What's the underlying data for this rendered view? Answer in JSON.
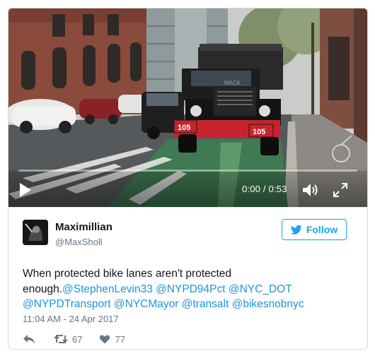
{
  "video": {
    "truck_number_left": "105",
    "truck_number_right": "105",
    "brand_label": "MACK",
    "progress": 0.0,
    "time_display": "0:00 / 0:53",
    "play_icon": "play-icon",
    "volume_icon": "volume-icon",
    "fullscreen_icon": "fullscreen-icon"
  },
  "tweet": {
    "name": "Maximillian",
    "handle": "@MaxSholl",
    "follow_label": "Follow",
    "text_plain": "When protected bike lanes aren't protected enough.",
    "mentions": [
      "@StephenLevin33",
      "@NYPD94Pct",
      "@NYC_DOT",
      "@NYPDTransport",
      "@NYCMayor",
      "@transalt",
      "@bikesnobnyc"
    ],
    "timestamp": "11:04 AM - 24 Apr 2017",
    "retweets": "67",
    "likes": "77"
  },
  "colors": {
    "link": "#1b95e0",
    "follow_blue": "#1da1f2",
    "truck_red": "#c8232c",
    "bike_lane_green": "#3f7a52"
  }
}
